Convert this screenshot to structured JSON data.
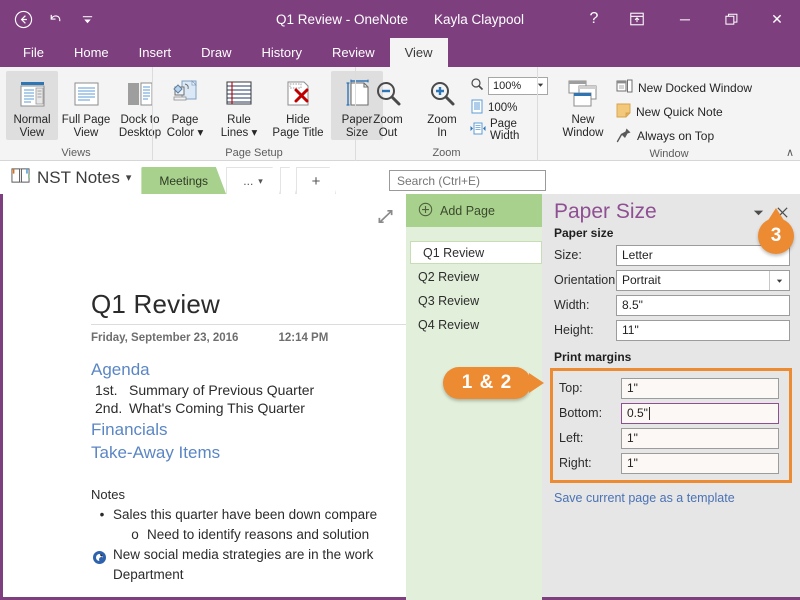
{
  "titlebar": {
    "back_icon": "back-circle-icon",
    "undo_icon": "undo-icon",
    "qat_more_icon": "chevron-down-icon",
    "app_title": "Q1 Review - OneNote",
    "account_name": "Kayla Claypool",
    "help_label": "?",
    "ribbon_display_icon": "ribbon-display-options-icon",
    "minimize_label": "─",
    "restore_label": "❐",
    "close_label": "✕",
    "background_color": "#7e3f7f"
  },
  "ribbon_tabs": [
    {
      "label": "File",
      "active": false
    },
    {
      "label": "Home",
      "active": false
    },
    {
      "label": "Insert",
      "active": false
    },
    {
      "label": "Draw",
      "active": false
    },
    {
      "label": "History",
      "active": false
    },
    {
      "label": "Review",
      "active": false
    },
    {
      "label": "View",
      "active": true
    }
  ],
  "ribbon": {
    "groups": [
      {
        "name": "Views",
        "label": "Views",
        "buttons": [
          {
            "label_line1": "Normal",
            "label_line2": "View",
            "icon": "normal-view-icon",
            "selected": true
          },
          {
            "label_line1": "Full Page",
            "label_line2": "View",
            "icon": "full-page-view-icon",
            "selected": false
          },
          {
            "label_line1": "Dock to",
            "label_line2": "Desktop",
            "icon": "dock-to-desktop-icon",
            "selected": false
          }
        ]
      },
      {
        "name": "Page Setup",
        "label": "Page Setup",
        "buttons": [
          {
            "label_line1": "Page",
            "label_line2": "Color ▾",
            "icon": "page-color-icon",
            "selected": false
          },
          {
            "label_line1": "Rule",
            "label_line2": "Lines ▾",
            "icon": "rule-lines-icon",
            "selected": false
          },
          {
            "label_line1": "Hide",
            "label_line2": "Page Title",
            "icon": "hide-page-title-icon",
            "selected": false
          },
          {
            "label_line1": "Paper",
            "label_line2": "Size",
            "icon": "paper-size-icon",
            "selected": true
          }
        ]
      },
      {
        "name": "Zoom",
        "label": "Zoom",
        "buttons": [
          {
            "label_line1": "Zoom",
            "label_line2": "Out",
            "icon": "zoom-out-icon",
            "selected": false
          },
          {
            "label_line1": "Zoom",
            "label_line2": "In",
            "icon": "zoom-in-icon",
            "selected": false
          }
        ],
        "zoom_value": "100%",
        "zoom_100_label": "100%",
        "page_width_label": "Page Width"
      },
      {
        "name": "Window",
        "label": "Window",
        "buttons": [
          {
            "label_line1": "New",
            "label_line2": "Window",
            "icon": "new-window-icon",
            "selected": false
          }
        ],
        "items": [
          {
            "label": "New Docked Window",
            "icon": "new-docked-window-icon"
          },
          {
            "label": "New Quick Note",
            "icon": "new-quick-note-icon"
          },
          {
            "label": "Always on Top",
            "icon": "pin-icon"
          }
        ]
      }
    ],
    "collapse_label": "∧"
  },
  "notebook_bar": {
    "notebook_icon": "notebook-icon",
    "notebook_name": "NST Notes",
    "notebook_caret": "▾",
    "section_tabs": [
      {
        "label": "Meetings",
        "active": true
      }
    ],
    "section_more_label": "...",
    "section_more_caret": "▾",
    "add_section_label": "+",
    "search_placeholder": "Search (Ctrl+E)",
    "search_value": ""
  },
  "page": {
    "expand_icon": "full-page-view-arrow-icon",
    "title": "Q1 Review",
    "date": "Friday, September 23, 2016",
    "time": "12:14 PM",
    "heading_agenda": "Agenda",
    "numbered": [
      {
        "n": "1st.",
        "text": "Summary of Previous Quarter"
      },
      {
        "n": "2nd.",
        "text": "What's Coming This Quarter"
      }
    ],
    "heading_financials": "Financials",
    "heading_takeaway": "Take-Away Items",
    "notes_heading": "Notes",
    "bullets": [
      {
        "level": 1,
        "marker": "•",
        "text": "Sales this quarter have been down compare"
      },
      {
        "level": 2,
        "marker": "o",
        "text": "Need to identify reasons and solution"
      },
      {
        "level": 1,
        "marker": "•",
        "text": "New social media strategies are in the work"
      },
      {
        "level": 1,
        "marker": "",
        "text": "Department"
      }
    ]
  },
  "page_list": {
    "add_page_icon": "add-page-icon",
    "add_page_label": "Add Page",
    "pages": [
      {
        "label": "Q1 Review",
        "selected": true
      },
      {
        "label": "Q2 Review",
        "selected": false
      },
      {
        "label": "Q3 Review",
        "selected": false
      },
      {
        "label": "Q4 Review",
        "selected": false
      }
    ]
  },
  "task_pane": {
    "title": "Paper Size",
    "menu_icon": "chevron-down-icon",
    "close_icon": "close-icon",
    "section_paper_size": "Paper size",
    "fields": [
      {
        "label": "Size:",
        "value": "Letter",
        "type": "text"
      },
      {
        "label": "Orientation:",
        "value": "Portrait",
        "type": "combo"
      },
      {
        "label": "Width:",
        "value": "8.5\"",
        "type": "text"
      },
      {
        "label": "Height:",
        "value": "11\"",
        "type": "text"
      }
    ],
    "section_print_margins": "Print margins",
    "margin_fields": [
      {
        "label": "Top:",
        "value": "1\"",
        "focused": false
      },
      {
        "label": "Bottom:",
        "value": "0.5\"",
        "focused": true
      },
      {
        "label": "Left:",
        "value": "1\"",
        "focused": false
      },
      {
        "label": "Right:",
        "value": "1\"",
        "focused": false
      }
    ],
    "template_link": "Save current page as a template",
    "highlight_color": "#ed8b33"
  },
  "callouts": [
    {
      "id": "callout-1-2",
      "label": "1 & 2"
    },
    {
      "id": "callout-3",
      "label": "3"
    }
  ]
}
